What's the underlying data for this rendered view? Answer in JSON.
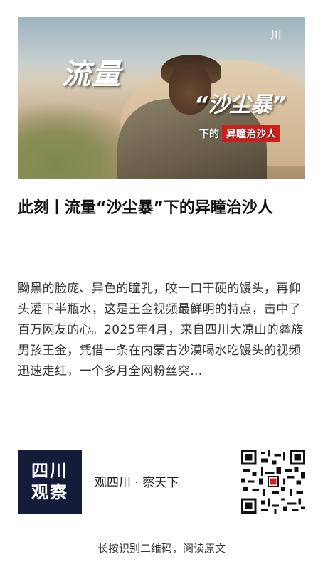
{
  "hero": {
    "logo_text": "川",
    "title_line1": "流量",
    "title_line2": "“沙尘暴”",
    "subtitle_prefix": "下的",
    "subtitle_tag": "异瞳治沙人"
  },
  "article": {
    "title": "此刻丨流量“沙尘暴”下的异瞳治沙人",
    "summary": "黝黑的脸庞、异色的瞳孔，咬一口干硬的馒头，再仰头灌下半瓶水，这是王金视频最鲜明的特点，击中了百万网友的心。2025年4月，来自四川大凉山的彝族男孩王金，凭借一条在内蒙古沙漠喝水吃馒头的视频迅速走红，一个多月全网粉丝突…"
  },
  "brand": {
    "logo_line1": "四川",
    "logo_line2": "观察",
    "slogan": "观四川 · 察天下"
  },
  "footer": {
    "hint": "长按识别二维码，阅读原文"
  }
}
